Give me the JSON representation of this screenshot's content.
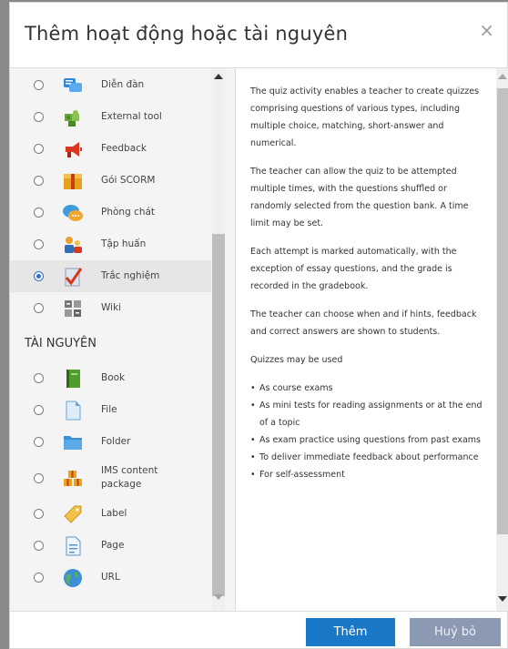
{
  "dialog": {
    "title": "Thêm hoạt động hoặc tài nguyên",
    "close_glyph": "×"
  },
  "activities": [
    {
      "label": "Diễn đàn",
      "icon": "forum-icon",
      "selected": false
    },
    {
      "label": "External tool",
      "icon": "puzzle-icon",
      "selected": false
    },
    {
      "label": "Feedback",
      "icon": "megaphone-icon",
      "selected": false
    },
    {
      "label": "Gói SCORM",
      "icon": "package-icon",
      "selected": false
    },
    {
      "label": "Phòng chát",
      "icon": "chat-icon",
      "selected": false
    },
    {
      "label": "Tập huấn",
      "icon": "workshop-icon",
      "selected": false
    },
    {
      "label": "Trắc nghiệm",
      "icon": "quiz-icon",
      "selected": true
    },
    {
      "label": "Wiki",
      "icon": "wiki-icon",
      "selected": false
    }
  ],
  "resources_heading": "TÀI NGUYÊN",
  "resources": [
    {
      "label": "Book",
      "icon": "book-icon"
    },
    {
      "label": "File",
      "icon": "file-icon"
    },
    {
      "label": "Folder",
      "icon": "folder-icon"
    },
    {
      "label": "IMS content package",
      "icon": "ims-package-icon"
    },
    {
      "label": "Label",
      "icon": "label-icon"
    },
    {
      "label": "Page",
      "icon": "page-icon"
    },
    {
      "label": "URL",
      "icon": "globe-icon"
    }
  ],
  "help": {
    "paragraphs": [
      "The quiz activity enables a teacher to create quizzes comprising questions of various types, including multiple choice, matching, short-answer and numerical.",
      "The teacher can allow the quiz to be attempted multiple times, with the questions shuffled or randomly selected from the question bank. A time limit may be set.",
      "Each attempt is marked automatically, with the exception of essay questions, and the grade is recorded in the gradebook.",
      "The teacher can choose when and if hints, feedback and correct answers are shown to students.",
      "Quizzes may be used"
    ],
    "bullets": [
      "As course exams",
      "As mini tests for reading assignments or at the end of a topic",
      "As exam practice using questions from past exams",
      "To deliver immediate feedback about performance",
      "For self-assessment"
    ]
  },
  "footer": {
    "add_label": "Thêm",
    "cancel_label": "Huỷ bỏ"
  },
  "colors": {
    "primary": "#1a78c9",
    "secondary": "#8b9ab2",
    "radio_selected": "#2b6fd1"
  }
}
